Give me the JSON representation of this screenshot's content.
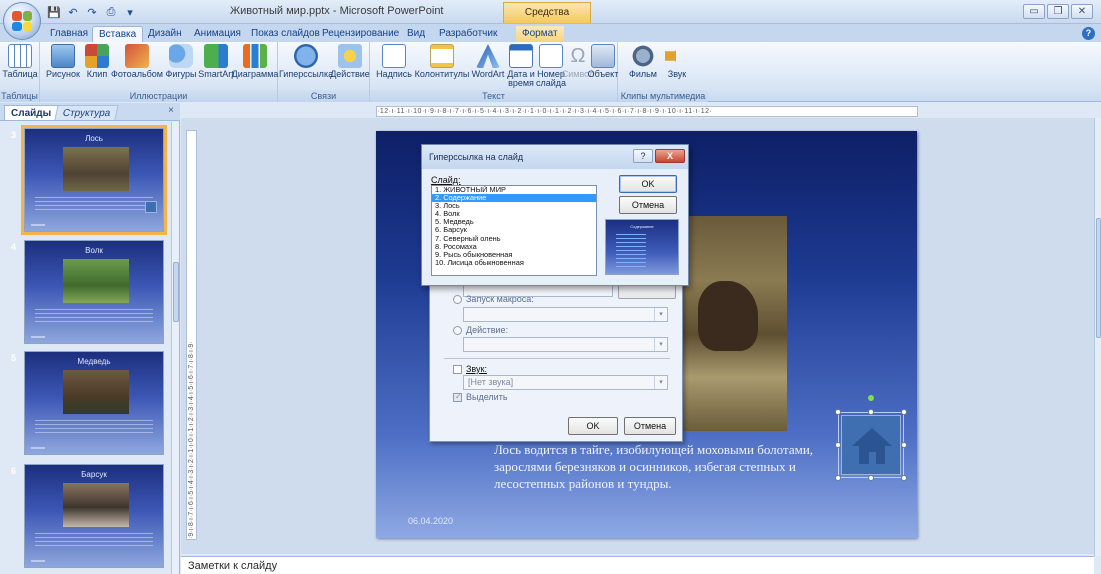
{
  "window": {
    "title": "Животный мир.pptx - Microsoft PowerPoint",
    "context_title": "Средства рисования"
  },
  "ribbon": {
    "tabs": [
      "Главная",
      "Вставка",
      "Дизайн",
      "Анимация",
      "Показ слайдов",
      "Рецензирование",
      "Вид",
      "Разработчик",
      "Формат"
    ],
    "active_tab": "Вставка",
    "groups": [
      {
        "label": "Таблицы",
        "buttons": [
          "Таблица"
        ]
      },
      {
        "label": "Иллюстрации",
        "buttons": [
          "Рисунок",
          "Клип",
          "Фотоальбом",
          "Фигуры",
          "SmartArt",
          "Диаграмма"
        ]
      },
      {
        "label": "Связи",
        "buttons": [
          "Гиперссылка",
          "Действие"
        ]
      },
      {
        "label": "Текст",
        "buttons": [
          "Надпись",
          "Колонтитулы",
          "WordArt",
          "Дата и время",
          "Номер слайда",
          "Символ",
          "Объект"
        ]
      },
      {
        "label": "Клипы мультимедиа",
        "buttons": [
          "Фильм",
          "Звук"
        ]
      }
    ]
  },
  "left_pane": {
    "tab_slides": "Слайды",
    "tab_outline": "Структура",
    "close": "×",
    "thumbnails": [
      {
        "num": "3",
        "title": "Лось"
      },
      {
        "num": "4",
        "title": "Волк"
      },
      {
        "num": "5",
        "title": "Медведь"
      },
      {
        "num": "6",
        "title": "Барсук"
      }
    ]
  },
  "rulers": {
    "horizontal": "·12·ı·11·ı·10·ı·9·ı·8·ı·7·ı·6·ı·5·ı·4·ı·3·ı·2·ı·1·ı·0·ı·1·ı·2·ı·3·ı·4·ı·5·ı·6·ı·7·ı·8·ı·9·ı·10·ı·11·ı·12·",
    "vertical": "·9·ı·8·ı·7·ı·6·ı·5·ı·4·ı·3·ı·2·ı·1·ı·0·ı·1·ı·2·ı·3·ı·4·ı·5·ı·6·ı·7·ı·8·ı·9·"
  },
  "slide": {
    "body": "Лось водится в тайге, изобилующей моховыми болотами, зарослями березняков и осинников, избегая степных и лесостепных районов и тундры.",
    "date": "06.04.2020"
  },
  "hyperlink_dialog": {
    "macro_label": "Запуск макроса:",
    "action_label": "Действие:",
    "sound_label": "Звук:",
    "sound_value": "[Нет звука]",
    "highlight_label": "Выделить",
    "ok": "OK",
    "cancel": "Отмена"
  },
  "slide_dialog": {
    "title": "Гиперссылка на слайд",
    "help": "?",
    "close": "X",
    "list_label": "Слайд:",
    "slides": [
      "1. ЖИВОТНЫЙ МИР",
      "2. Содержание",
      "3. Лось",
      "4. Волк",
      "5. Медведь",
      "6. Барсук",
      "7. Северный олень",
      "8. Росомаха",
      "9. Рысь обыкновенная",
      "10. Лисица обыкновенная"
    ],
    "selected_index": 1,
    "preview_title": "Содержание",
    "ok": "OK",
    "cancel": "Отмена"
  },
  "notes": {
    "placeholder": "Заметки к слайду"
  },
  "colors": {
    "accent": "#15428b",
    "selection": "#3399ff",
    "thumb_selected": "#f4b44a"
  }
}
